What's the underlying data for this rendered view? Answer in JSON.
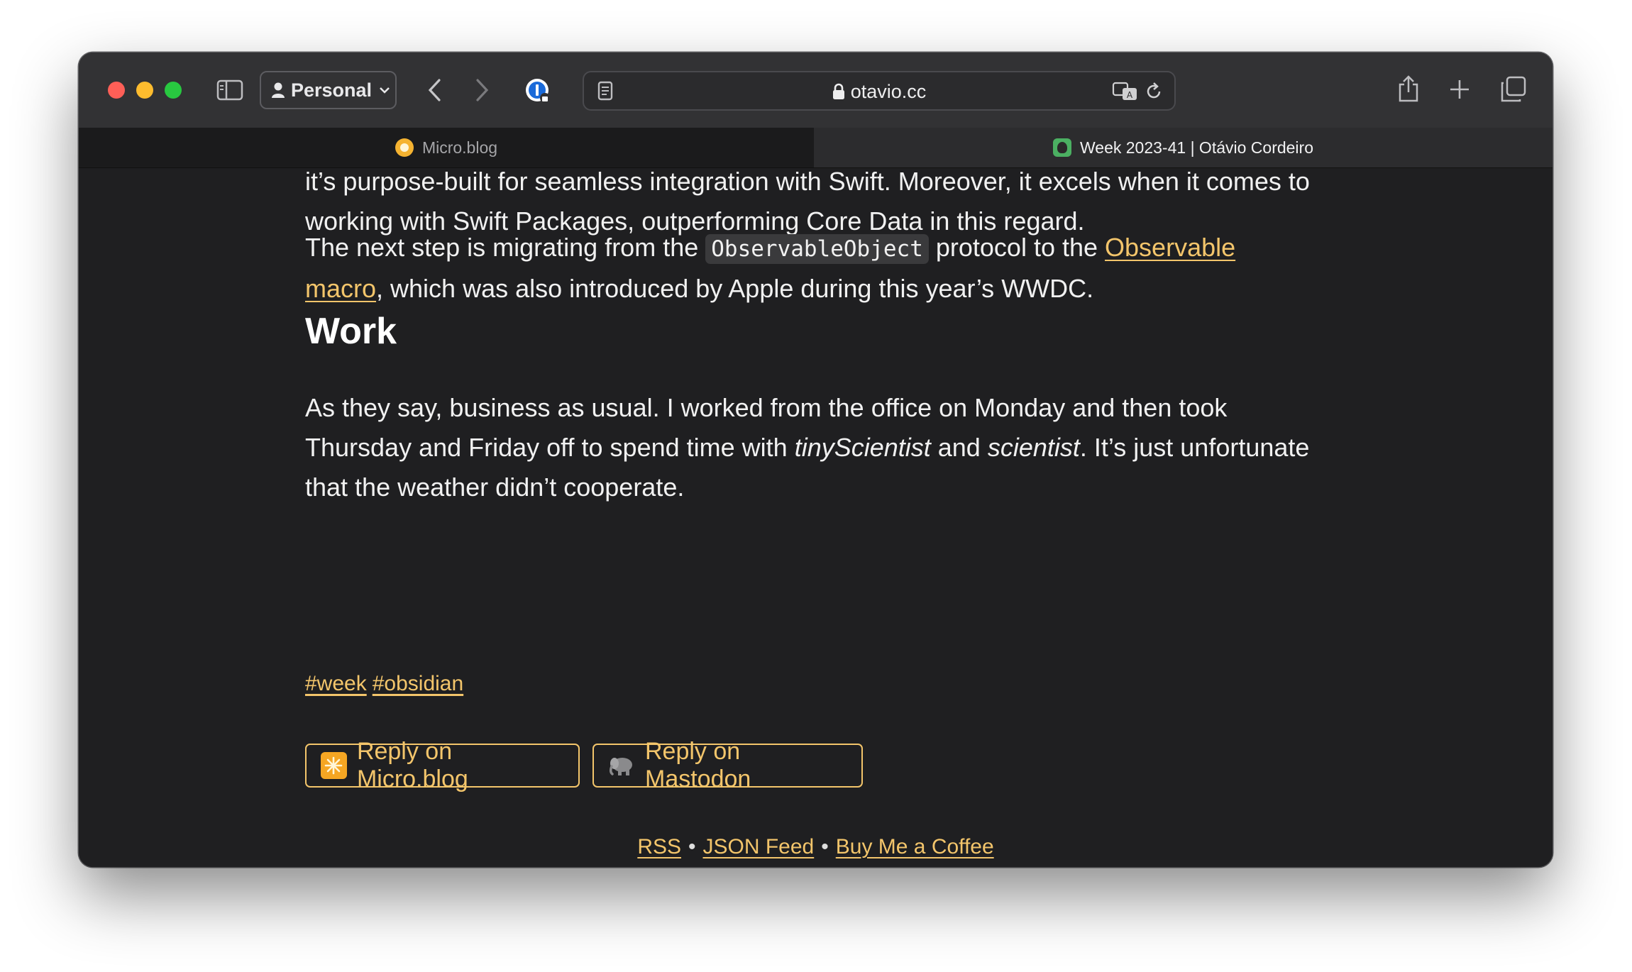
{
  "browser": {
    "profile_label": "Personal",
    "url": "otavio.cc",
    "tabs": [
      {
        "label": "Micro.blog",
        "active": false
      },
      {
        "label": "Week 2023-41 | Otávio Cordeiro",
        "active": true
      }
    ]
  },
  "article": {
    "p1_line1": "it’s purpose-built for seamless integration with Swift. Moreover, it excels when it comes to",
    "p1_line2": "working with Swift Packages, outperforming Core Data in this regard.",
    "p2_a": "The next step is migrating from the ",
    "p2_code": "ObservableObject",
    "p2_b": " protocol to the ",
    "p2_link1": "Observable",
    "p2_link2": "macro",
    "p2_c": ", which was also introduced by Apple during this year’s WWDC.",
    "heading": "Work",
    "p3_line1": "As they say, business as usual. I worked from the office on Monday and then took",
    "p3_line2_a": "Thursday and Friday off to spend time with ",
    "p3_em1": "tinyScientist",
    "p3_line2_b": " and ",
    "p3_em2": "scientist",
    "p3_line2_c": ". It’s just unfortunate",
    "p3_line3": "that the weather didn’t cooperate.",
    "tags": [
      "#week",
      "#obsidian"
    ],
    "reply_microblog": "Reply on Micro.blog",
    "reply_mastodon": "Reply on Mastodon"
  },
  "footer": {
    "rss": "RSS",
    "json_feed": "JSON Feed",
    "coffee": "Buy Me a Coffee",
    "separator": "•"
  },
  "colors": {
    "link": "#f3c56b",
    "background": "#1f1f21",
    "text": "#f1f1f1"
  }
}
